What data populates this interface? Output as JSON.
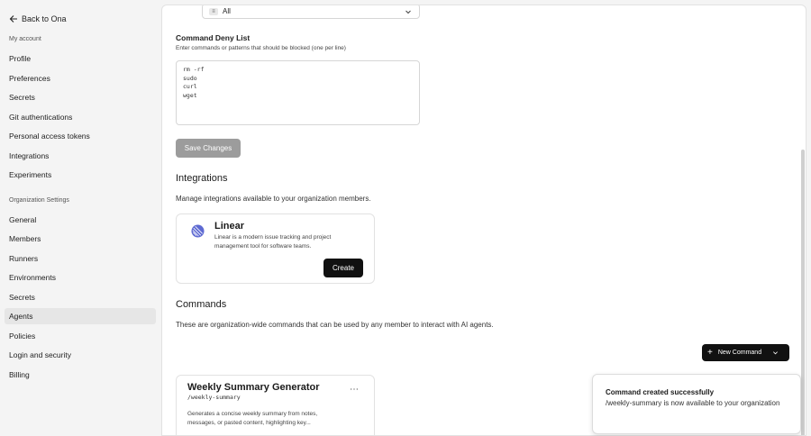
{
  "sidebar": {
    "back_label": "Back to Ona",
    "my_account_label": "My account",
    "my_account_items": [
      "Profile",
      "Preferences",
      "Secrets",
      "Git authentications",
      "Personal access tokens",
      "Integrations",
      "Experiments"
    ],
    "org_label": "Organization Settings",
    "org_items": [
      "General",
      "Members",
      "Runners",
      "Environments",
      "Secrets",
      "Agents",
      "Policies",
      "Login and security",
      "Billing"
    ],
    "active_item": "Agents"
  },
  "select": {
    "value": "All",
    "icon": "tag-icon"
  },
  "deny_list": {
    "title": "Command Deny List",
    "subtitle": "Enter commands or patterns that should be blocked (one per line)",
    "lines": "rm -rf\nsudo\ncurl\nwget"
  },
  "save_button": "Save Changes",
  "integrations": {
    "title": "Integrations",
    "description": "Manage integrations available to your organization members.",
    "card": {
      "name": "Linear",
      "description": "Linear is a modern issue tracking and project management tool for software teams.",
      "button": "Create"
    }
  },
  "commands": {
    "title": "Commands",
    "description": "These are organization-wide commands that can be used by any member to interact with AI agents.",
    "new_button": "New Command",
    "card": {
      "name": "Weekly Summary Generator",
      "slug": "/weekly-summary",
      "description": "Generates a concise weekly summary from notes, messages, or pasted content, highlighting key..."
    }
  },
  "toast": {
    "bold": "Command created successfully",
    "rest": "/weekly-summary is now available to your organization"
  },
  "colors": {
    "accent": "#111111",
    "linear": "#5e6ad2"
  }
}
